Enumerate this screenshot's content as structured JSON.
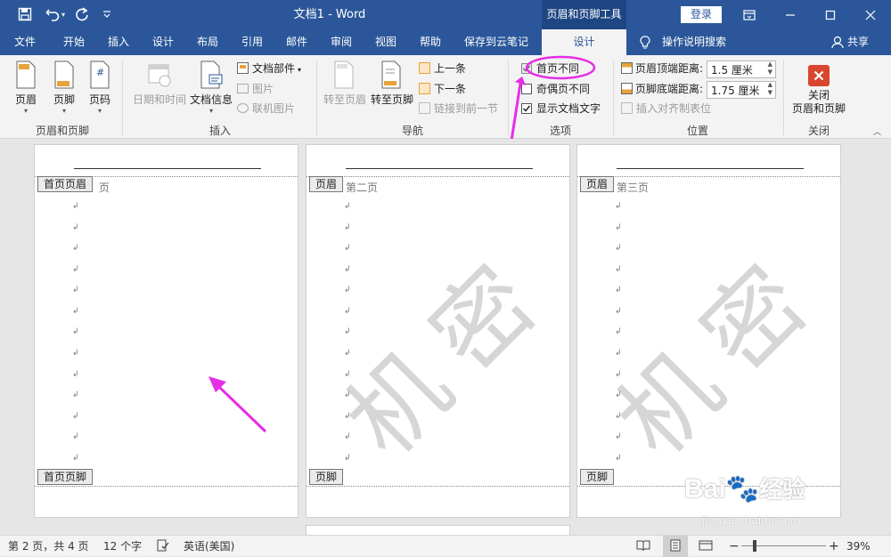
{
  "title_bar": {
    "doc_title": "文档1  -  Word",
    "context_tab": "页眉和页脚工具",
    "login": "登录",
    "icons": [
      "save-icon",
      "undo-icon",
      "redo-icon",
      "customize-icon",
      "ribbon-options-icon",
      "minimize-icon",
      "maximize-icon",
      "close-icon"
    ]
  },
  "menu": {
    "items": [
      "文件",
      "开始",
      "插入",
      "设计",
      "布局",
      "引用",
      "邮件",
      "审阅",
      "视图",
      "帮助",
      "保存到云笔记"
    ],
    "active_tab": "设计",
    "search": "操作说明搜索",
    "share": "共享"
  },
  "ribbon": {
    "groups": {
      "header_footer": {
        "label": "页眉和页脚",
        "header": "页眉",
        "footer": "页脚",
        "page_number": "页码"
      },
      "insert": {
        "label": "插入",
        "date_time": "日期和时间",
        "doc_info": "文档信息",
        "quick_parts": "文档部件",
        "picture": "图片",
        "online_picture": "联机图片"
      },
      "navigation": {
        "label": "导航",
        "goto_header": "转至页眉",
        "goto_footer": "转至页脚",
        "previous": "上一条",
        "next": "下一条",
        "link_previous": "链接到前一节"
      },
      "options": {
        "label": "选项",
        "diff_first_page": "首页不同",
        "diff_odd_even": "奇偶页不同",
        "show_doc_text": "显示文档文字",
        "diff_first_page_checked": true,
        "diff_odd_even_checked": false,
        "show_doc_text_checked": true
      },
      "position": {
        "label": "位置",
        "header_top": "页眉顶端距离:",
        "header_top_value": "1.5 厘米",
        "footer_bottom": "页脚底端距离:",
        "footer_bottom_value": "1.75 厘米",
        "insert_align_tab": "插入对齐制表位"
      },
      "close": {
        "label": "关闭",
        "close_btn_line1": "关闭",
        "close_btn_line2": "页眉和页脚"
      }
    }
  },
  "pages": [
    {
      "header_tag": "首页页眉",
      "header_text": "页",
      "footer_tag": "首页页脚"
    },
    {
      "header_tag": "页眉",
      "header_text": "第二页",
      "footer_tag": "页脚",
      "watermark": "机密"
    },
    {
      "header_tag": "页眉",
      "header_text": "第三页",
      "footer_tag": "页脚",
      "watermark": "机密"
    }
  ],
  "brand_watermark": {
    "text": "Bai",
    "text2": "经验",
    "url": "jingyan.baidu.com"
  },
  "status": {
    "page": "第 2 页，共 4 页",
    "words": "12 个字",
    "language": "英语(美国)",
    "zoom": "39%",
    "zoom_minus": "−",
    "zoom_plus": "+"
  },
  "colors": {
    "title_bar": "#2b579a",
    "annotation": "#e62ee6",
    "close_icon": "#d9452f"
  }
}
